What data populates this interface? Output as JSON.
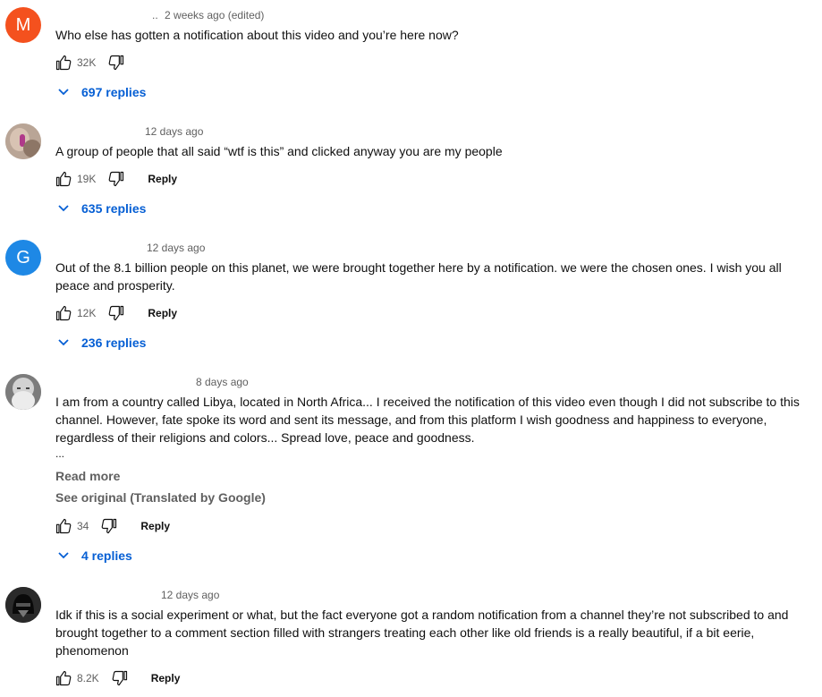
{
  "comments": [
    {
      "avatar_letter": "M",
      "avatar_color": "#f4511e",
      "author_redacted_text": "..",
      "timestamp": "2 weeks ago (edited)",
      "text": "Who else has gotten a notification about this video and you’re here now?",
      "likes": "32K",
      "replies_label": "697 replies"
    },
    {
      "avatar_image": "photo-avatar",
      "timestamp": "12 days ago",
      "text": "A group of people that all said “wtf is this” and clicked anyway you are my people",
      "likes": "19K",
      "reply_label": "Reply",
      "replies_label": "635 replies"
    },
    {
      "avatar_letter": "G",
      "avatar_color": "#1e88e5",
      "timestamp": "12 days ago",
      "text": "Out of the 8.1 billion people on this planet, we were brought together here by a notification. we were the chosen ones. I wish you all peace and prosperity.",
      "likes": "12K",
      "reply_label": "Reply",
      "replies_label": "236 replies"
    },
    {
      "avatar_image": "old-man-photo-avatar",
      "timestamp": "8 days ago",
      "text": "I am from a country called Libya, located in North Africa... I received the notification of this video even though I did not subscribe to this channel. However, fate spoke its word and sent its message, and from this platform I wish goodness and happiness to everyone, regardless of their religions and colors... Spread love, peace and goodness.",
      "ellipsis": "...",
      "read_more": "Read more",
      "see_original": "See original (Translated by Google)",
      "likes": "34",
      "reply_label": "Reply",
      "replies_label": "4 replies"
    },
    {
      "avatar_image": "helmet-photo-avatar",
      "timestamp": "12 days ago",
      "text": "Idk if this is a social experiment or what, but the fact everyone got a random notification from a channel they’re not subscribed to and brought together to a comment section filled with strangers treating each other like old friends is a really beautiful, if a bit eerie, phenomenon",
      "likes": "8.2K",
      "reply_label": "Reply"
    }
  ],
  "icons": {
    "like": "thumbs-up-icon",
    "dislike": "thumbs-down-icon",
    "expand": "chevron-down-icon"
  },
  "colors": {
    "link_blue": "#065fd4",
    "secondary_text": "#606060"
  }
}
